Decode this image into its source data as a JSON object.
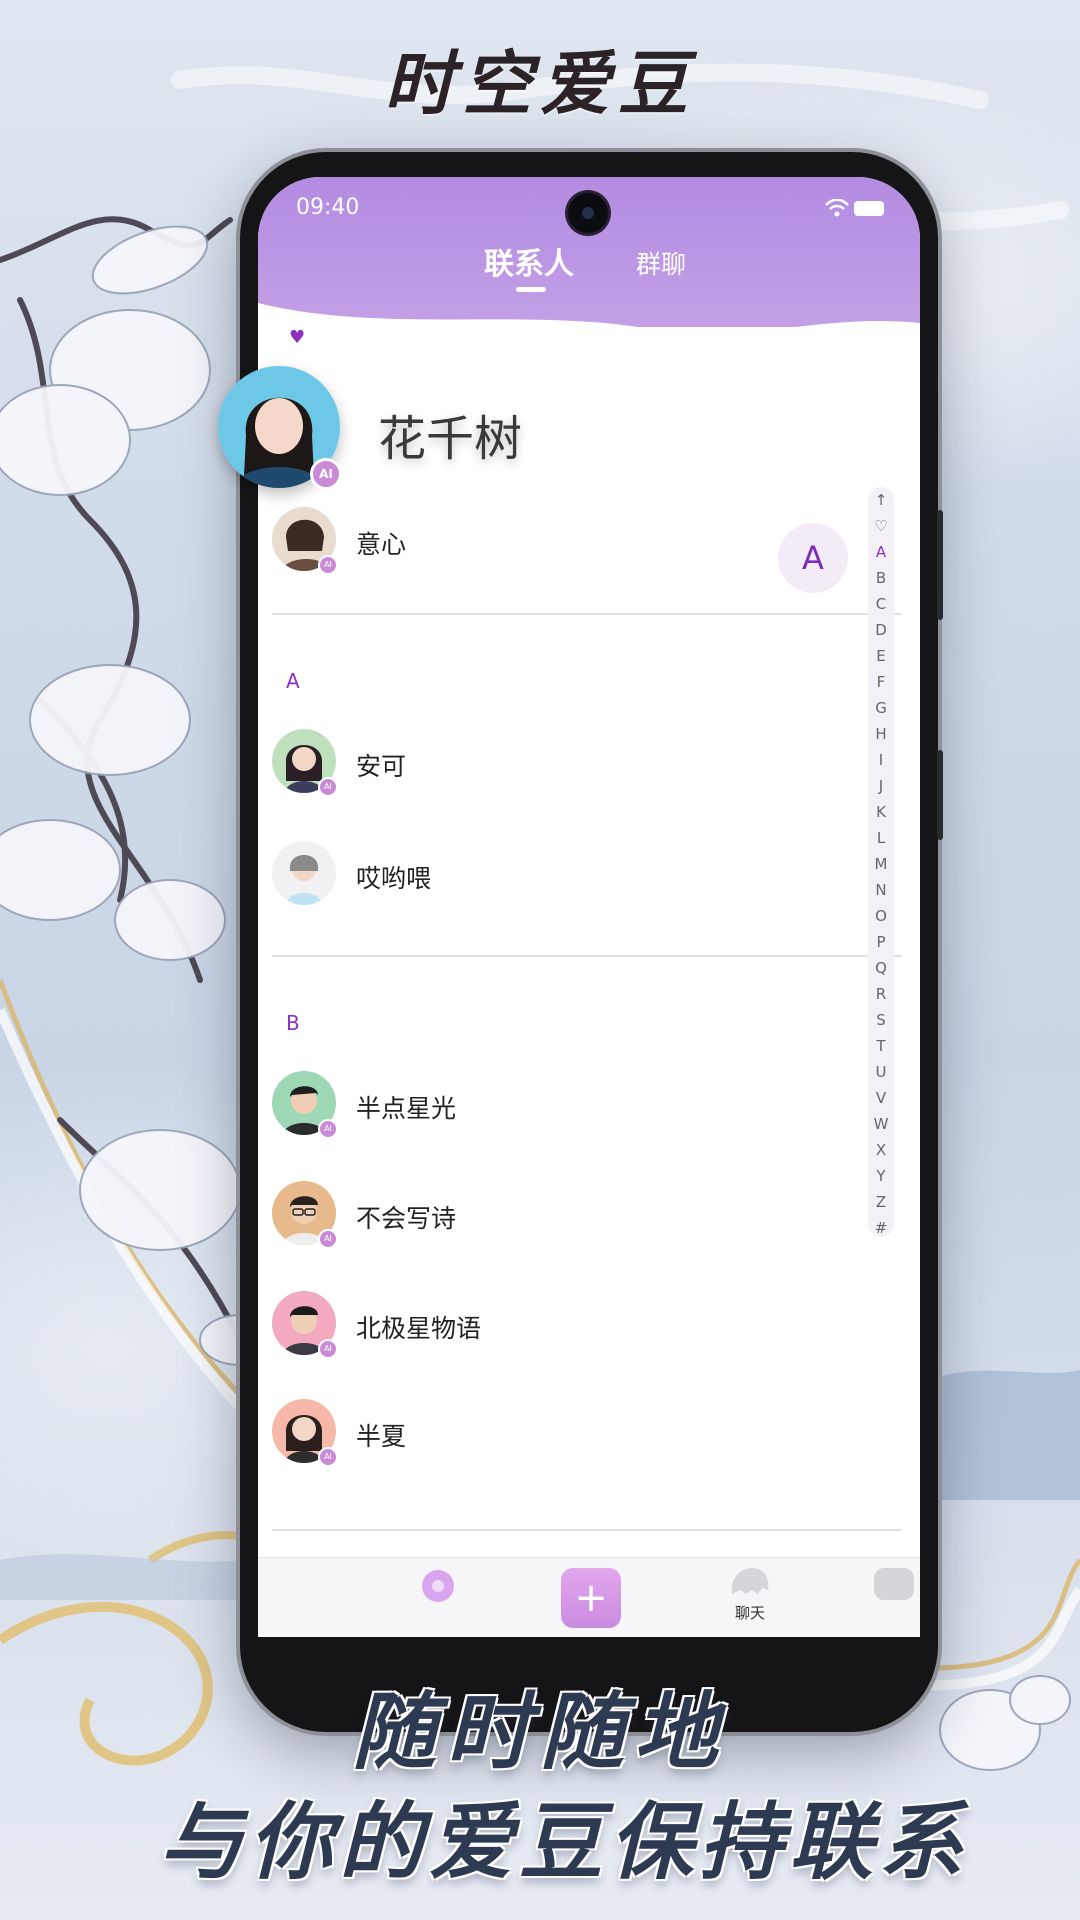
{
  "app_title": "时空爱豆",
  "status": {
    "time": "09:40"
  },
  "tabs": {
    "contacts": "联系人",
    "group_chat": "群聊"
  },
  "featured": {
    "name": "花千树",
    "badge": "AI"
  },
  "heart": "♥",
  "contacts_top": [
    {
      "name": "意心",
      "badge": "AI"
    }
  ],
  "sections": [
    {
      "letter": "A",
      "contacts": [
        {
          "name": "安可",
          "badge": "AI"
        },
        {
          "name": "哎哟喂",
          "badge": ""
        }
      ]
    },
    {
      "letter": "B",
      "contacts": [
        {
          "name": "半点星光",
          "badge": "AI"
        },
        {
          "name": "不会写诗",
          "badge": "AI"
        },
        {
          "name": "北极星物语",
          "badge": "AI"
        },
        {
          "name": "半夏",
          "badge": "AI"
        }
      ]
    }
  ],
  "index_bar": [
    "↑",
    "♡",
    "A",
    "B",
    "C",
    "D",
    "E",
    "F",
    "G",
    "H",
    "I",
    "J",
    "K",
    "L",
    "M",
    "N",
    "O",
    "P",
    "Q",
    "R",
    "S",
    "T",
    "U",
    "V",
    "W",
    "X",
    "Y",
    "Z",
    "#"
  ],
  "index_bubble": "A",
  "bottom_nav": {
    "chat_label": "聊天",
    "plus": "+"
  },
  "slogan": {
    "line1": "随时随地",
    "line2": "与你的爱豆保持联系"
  },
  "colors": {
    "accent": "#8a32c0",
    "header": "#b38be2",
    "ai_badge": "#c98ad6"
  }
}
